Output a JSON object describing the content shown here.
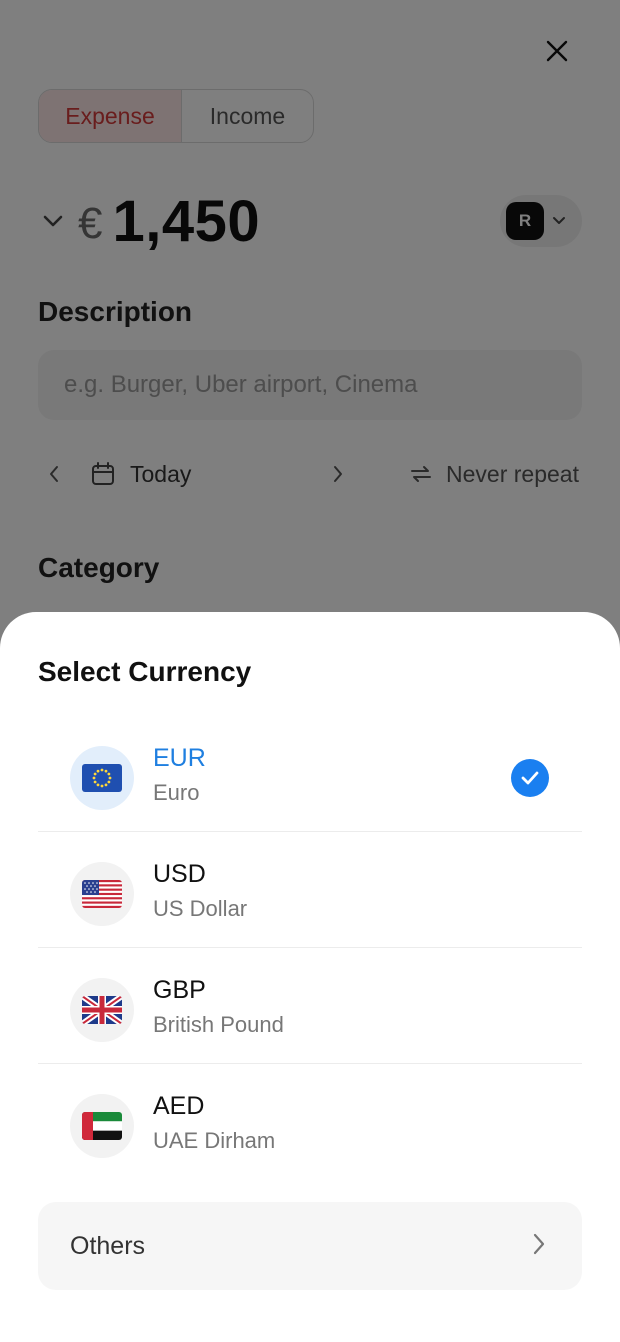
{
  "form": {
    "type_toggle": {
      "expense_label": "Expense",
      "income_label": "Income",
      "selected": "Expense"
    },
    "amount": {
      "symbol": "€",
      "value": "1,450"
    },
    "account": {
      "avatar_letter": "R"
    },
    "description": {
      "title": "Description",
      "placeholder": "e.g. Burger, Uber airport, Cinema"
    },
    "date": {
      "label": "Today"
    },
    "repeat": {
      "label": "Never repeat"
    },
    "category": {
      "title": "Category"
    }
  },
  "sheet": {
    "title": "Select Currency",
    "currencies": [
      {
        "code": "EUR",
        "name": "Euro",
        "flag": "eu-flag-icon",
        "selected": true
      },
      {
        "code": "USD",
        "name": "US Dollar",
        "flag": "us-flag-icon",
        "selected": false
      },
      {
        "code": "GBP",
        "name": "British Pound",
        "flag": "uk-flag-icon",
        "selected": false
      },
      {
        "code": "AED",
        "name": "UAE Dirham",
        "flag": "uae-flag-icon",
        "selected": false
      }
    ],
    "others_label": "Others"
  },
  "colors": {
    "accent": "#1a7ff0",
    "expense": "#d33a3a",
    "expense_bg": "#fde7e7"
  }
}
